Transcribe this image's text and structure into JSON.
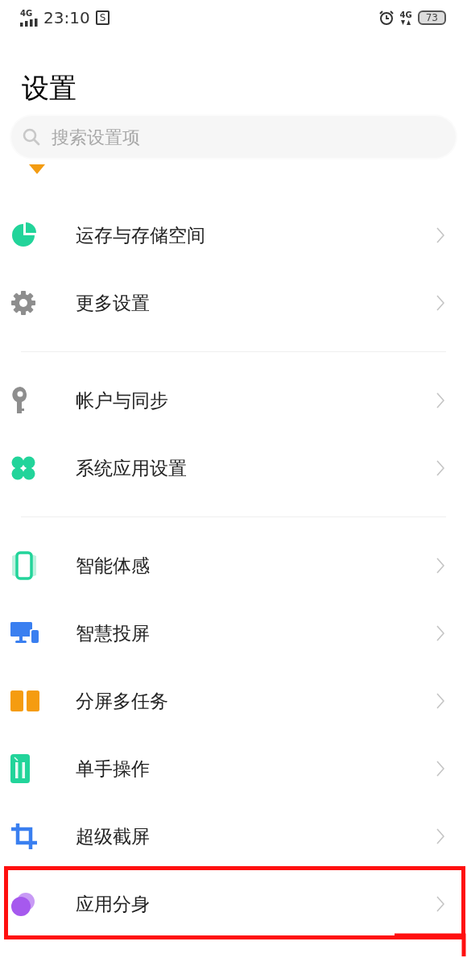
{
  "status_bar": {
    "network_left": "4G",
    "time": "23:10",
    "notification_glyph": "S",
    "network_right": "4G",
    "battery": "73"
  },
  "title": "设置",
  "search": {
    "placeholder": "搜索设置项"
  },
  "sections": [
    {
      "items": [
        {
          "label": "运存与存储空间",
          "highlighted": false
        },
        {
          "label": "更多设置",
          "highlighted": false
        }
      ]
    },
    {
      "items": [
        {
          "label": "帐户与同步",
          "highlighted": false
        },
        {
          "label": "系统应用设置",
          "highlighted": false
        }
      ]
    },
    {
      "items": [
        {
          "label": "智能体感",
          "highlighted": false
        },
        {
          "label": "智慧投屏",
          "highlighted": false
        },
        {
          "label": "分屏多任务",
          "highlighted": false
        },
        {
          "label": "单手操作",
          "highlighted": false
        },
        {
          "label": "超级截屏",
          "highlighted": false
        },
        {
          "label": "应用分身",
          "highlighted": true
        }
      ]
    }
  ]
}
